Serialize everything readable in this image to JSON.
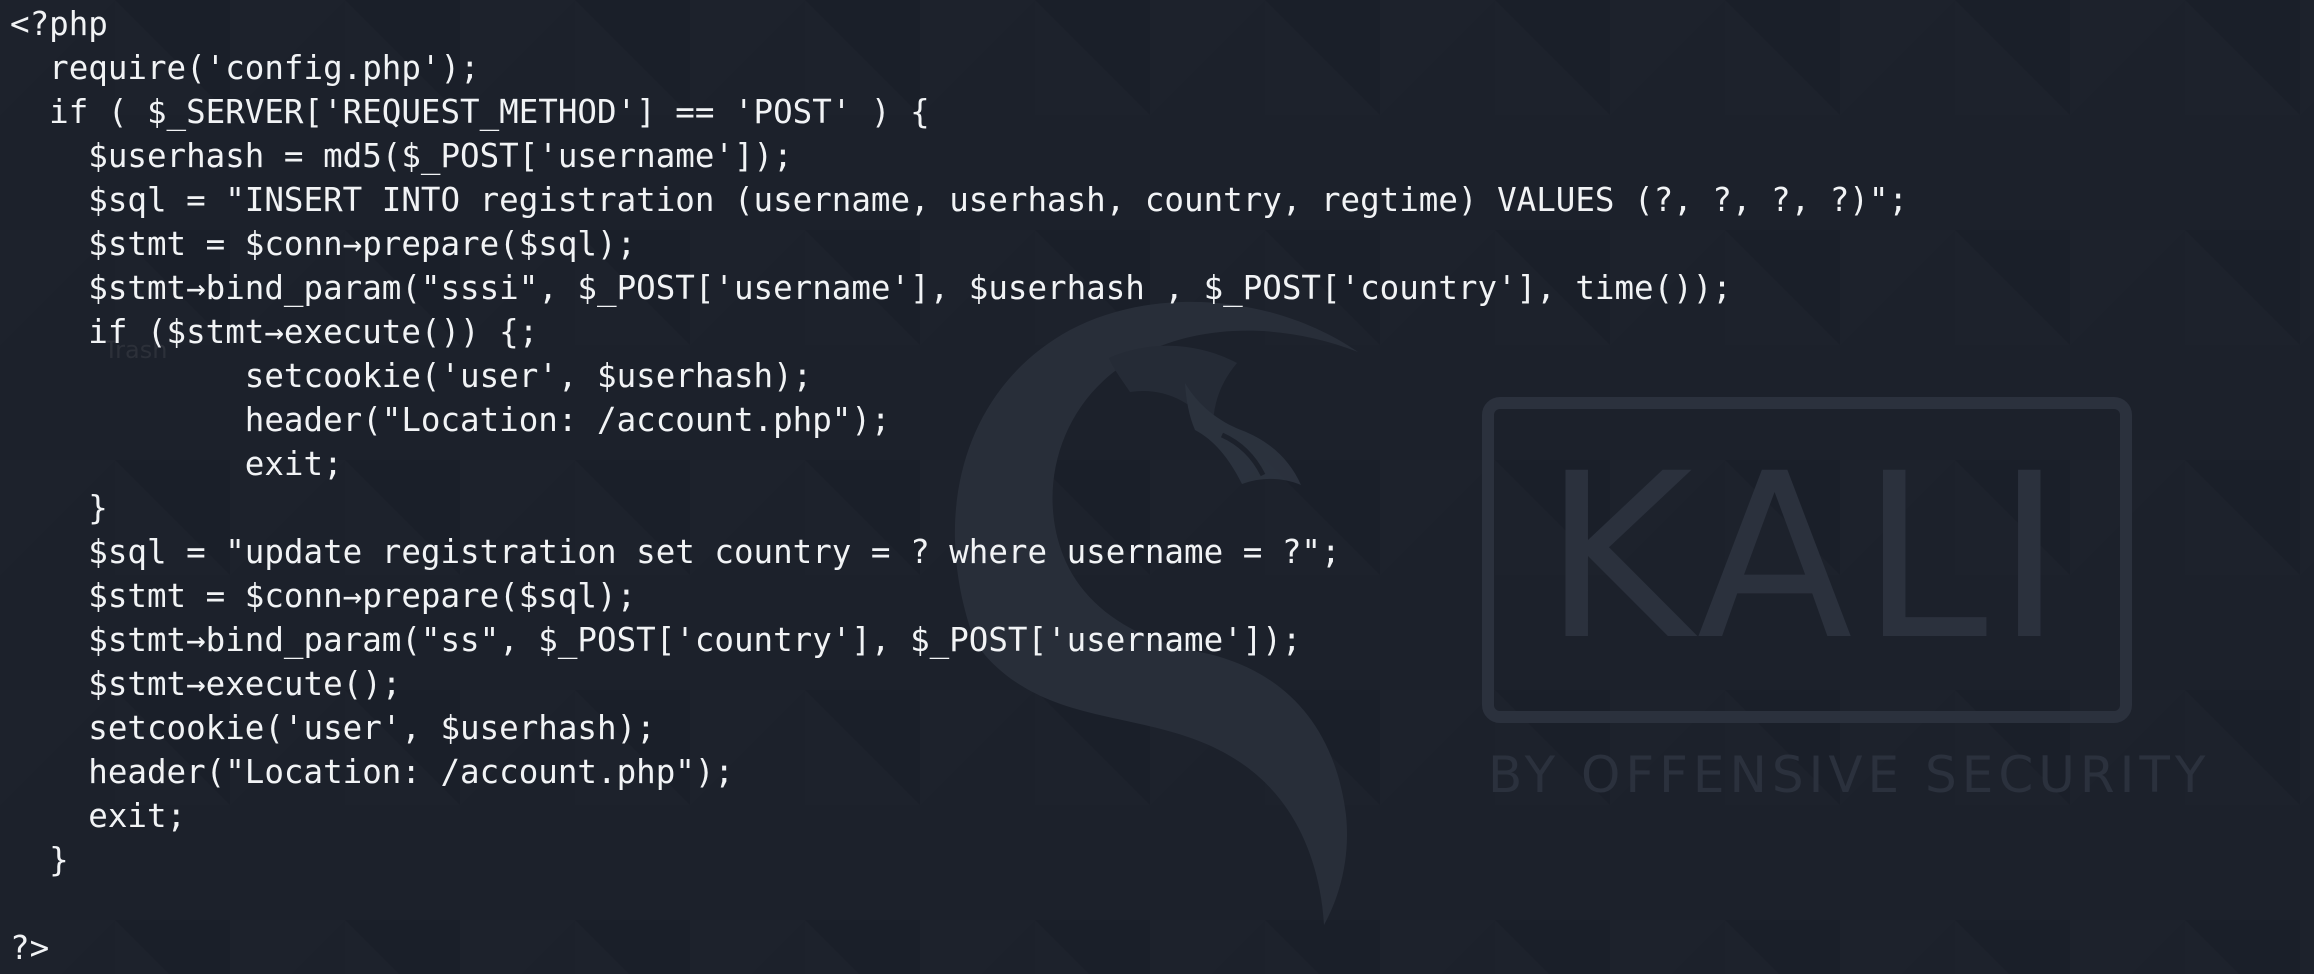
{
  "code_lines": [
    "<?php",
    "  require('config.php');",
    "  if ( $_SERVER['REQUEST_METHOD'] == 'POST' ) {",
    "    $userhash = md5($_POST['username']);",
    "    $sql = \"INSERT INTO registration (username, userhash, country, regtime) VALUES (?, ?, ?, ?)\";",
    "    $stmt = $conn→prepare($sql);",
    "    $stmt→bind_param(\"sssi\", $_POST['username'], $userhash , $_POST['country'], time());",
    "    if ($stmt→execute()) {;",
    "            setcookie('user', $userhash);",
    "            header(\"Location: /account.php\");",
    "            exit;",
    "    }",
    "    $sql = \"update registration set country = ? where username = ?\";",
    "    $stmt = $conn→prepare($sql);",
    "    $stmt→bind_param(\"ss\", $_POST['country'], $_POST['username']);",
    "    $stmt→execute();",
    "    setcookie('user', $userhash);",
    "    header(\"Location: /account.php\");",
    "    exit;",
    "  }",
    "",
    "?>"
  ],
  "wallpaper": {
    "logo_text": "KALI",
    "logo_subtitle": "BY OFFENSIVE SECURITY",
    "faint_label": "Trash",
    "background_color": "#1c212b",
    "logo_color": "#2b313d",
    "text_color": "#f1f3f5"
  }
}
